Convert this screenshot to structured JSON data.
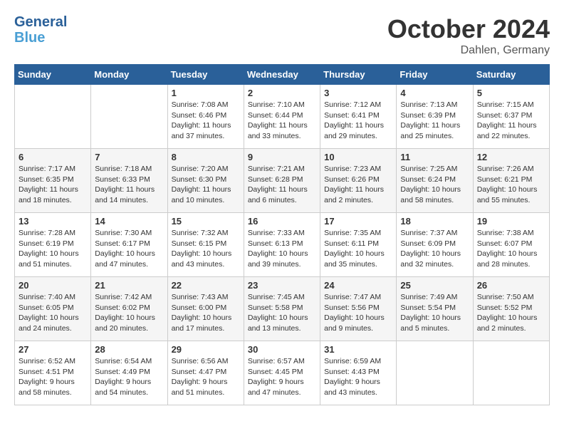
{
  "header": {
    "logo_line1": "General",
    "logo_line2": "Blue",
    "month": "October 2024",
    "location": "Dahlen, Germany"
  },
  "days_of_week": [
    "Sunday",
    "Monday",
    "Tuesday",
    "Wednesday",
    "Thursday",
    "Friday",
    "Saturday"
  ],
  "weeks": [
    [
      {
        "day": "",
        "info": ""
      },
      {
        "day": "",
        "info": ""
      },
      {
        "day": "1",
        "info": "Sunrise: 7:08 AM\nSunset: 6:46 PM\nDaylight: 11 hours and 37 minutes."
      },
      {
        "day": "2",
        "info": "Sunrise: 7:10 AM\nSunset: 6:44 PM\nDaylight: 11 hours and 33 minutes."
      },
      {
        "day": "3",
        "info": "Sunrise: 7:12 AM\nSunset: 6:41 PM\nDaylight: 11 hours and 29 minutes."
      },
      {
        "day": "4",
        "info": "Sunrise: 7:13 AM\nSunset: 6:39 PM\nDaylight: 11 hours and 25 minutes."
      },
      {
        "day": "5",
        "info": "Sunrise: 7:15 AM\nSunset: 6:37 PM\nDaylight: 11 hours and 22 minutes."
      }
    ],
    [
      {
        "day": "6",
        "info": "Sunrise: 7:17 AM\nSunset: 6:35 PM\nDaylight: 11 hours and 18 minutes."
      },
      {
        "day": "7",
        "info": "Sunrise: 7:18 AM\nSunset: 6:33 PM\nDaylight: 11 hours and 14 minutes."
      },
      {
        "day": "8",
        "info": "Sunrise: 7:20 AM\nSunset: 6:30 PM\nDaylight: 11 hours and 10 minutes."
      },
      {
        "day": "9",
        "info": "Sunrise: 7:21 AM\nSunset: 6:28 PM\nDaylight: 11 hours and 6 minutes."
      },
      {
        "day": "10",
        "info": "Sunrise: 7:23 AM\nSunset: 6:26 PM\nDaylight: 11 hours and 2 minutes."
      },
      {
        "day": "11",
        "info": "Sunrise: 7:25 AM\nSunset: 6:24 PM\nDaylight: 10 hours and 58 minutes."
      },
      {
        "day": "12",
        "info": "Sunrise: 7:26 AM\nSunset: 6:21 PM\nDaylight: 10 hours and 55 minutes."
      }
    ],
    [
      {
        "day": "13",
        "info": "Sunrise: 7:28 AM\nSunset: 6:19 PM\nDaylight: 10 hours and 51 minutes."
      },
      {
        "day": "14",
        "info": "Sunrise: 7:30 AM\nSunset: 6:17 PM\nDaylight: 10 hours and 47 minutes."
      },
      {
        "day": "15",
        "info": "Sunrise: 7:32 AM\nSunset: 6:15 PM\nDaylight: 10 hours and 43 minutes."
      },
      {
        "day": "16",
        "info": "Sunrise: 7:33 AM\nSunset: 6:13 PM\nDaylight: 10 hours and 39 minutes."
      },
      {
        "day": "17",
        "info": "Sunrise: 7:35 AM\nSunset: 6:11 PM\nDaylight: 10 hours and 35 minutes."
      },
      {
        "day": "18",
        "info": "Sunrise: 7:37 AM\nSunset: 6:09 PM\nDaylight: 10 hours and 32 minutes."
      },
      {
        "day": "19",
        "info": "Sunrise: 7:38 AM\nSunset: 6:07 PM\nDaylight: 10 hours and 28 minutes."
      }
    ],
    [
      {
        "day": "20",
        "info": "Sunrise: 7:40 AM\nSunset: 6:05 PM\nDaylight: 10 hours and 24 minutes."
      },
      {
        "day": "21",
        "info": "Sunrise: 7:42 AM\nSunset: 6:02 PM\nDaylight: 10 hours and 20 minutes."
      },
      {
        "day": "22",
        "info": "Sunrise: 7:43 AM\nSunset: 6:00 PM\nDaylight: 10 hours and 17 minutes."
      },
      {
        "day": "23",
        "info": "Sunrise: 7:45 AM\nSunset: 5:58 PM\nDaylight: 10 hours and 13 minutes."
      },
      {
        "day": "24",
        "info": "Sunrise: 7:47 AM\nSunset: 5:56 PM\nDaylight: 10 hours and 9 minutes."
      },
      {
        "day": "25",
        "info": "Sunrise: 7:49 AM\nSunset: 5:54 PM\nDaylight: 10 hours and 5 minutes."
      },
      {
        "day": "26",
        "info": "Sunrise: 7:50 AM\nSunset: 5:52 PM\nDaylight: 10 hours and 2 minutes."
      }
    ],
    [
      {
        "day": "27",
        "info": "Sunrise: 6:52 AM\nSunset: 4:51 PM\nDaylight: 9 hours and 58 minutes."
      },
      {
        "day": "28",
        "info": "Sunrise: 6:54 AM\nSunset: 4:49 PM\nDaylight: 9 hours and 54 minutes."
      },
      {
        "day": "29",
        "info": "Sunrise: 6:56 AM\nSunset: 4:47 PM\nDaylight: 9 hours and 51 minutes."
      },
      {
        "day": "30",
        "info": "Sunrise: 6:57 AM\nSunset: 4:45 PM\nDaylight: 9 hours and 47 minutes."
      },
      {
        "day": "31",
        "info": "Sunrise: 6:59 AM\nSunset: 4:43 PM\nDaylight: 9 hours and 43 minutes."
      },
      {
        "day": "",
        "info": ""
      },
      {
        "day": "",
        "info": ""
      }
    ]
  ]
}
